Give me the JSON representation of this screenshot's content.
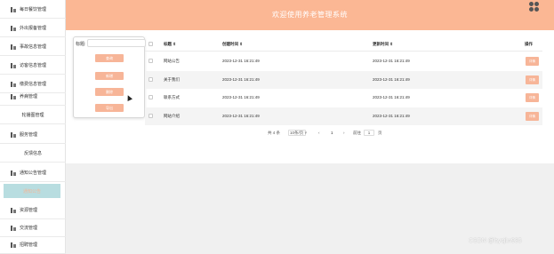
{
  "sidebar": {
    "items": [
      {
        "label": "每日餐饮管理"
      },
      {
        "label": "外出报备管理"
      },
      {
        "label": "事故信息管理"
      },
      {
        "label": "访客信息管理"
      },
      {
        "label": "缴费信息管理"
      },
      {
        "label": "养病管理"
      },
      {
        "label": "轮播图管理"
      },
      {
        "label": "服务管理"
      },
      {
        "label": "反馈信息"
      },
      {
        "label": "通知公告管理"
      },
      {
        "label": "通知公告"
      },
      {
        "label": "资源管理"
      },
      {
        "label": "交流管理"
      },
      {
        "label": "招聘管理"
      }
    ]
  },
  "header": {
    "title": "欢迎使用养老管理系统"
  },
  "search": {
    "label": "标题:",
    "buttons": [
      "查询",
      "新增",
      "删除",
      "导出"
    ]
  },
  "table": {
    "headers": [
      "标题",
      "创建时间",
      "更新时间",
      "操作"
    ],
    "rows": [
      {
        "title": "网站公告",
        "created": "2023-12-31 16:21:49",
        "updated": "2023-12-31 16:21:49",
        "action": "详情"
      },
      {
        "title": "关于我们",
        "created": "2023-12-31 16:21:49",
        "updated": "2023-12-31 16:21:49",
        "action": "详情"
      },
      {
        "title": "联系方式",
        "created": "2023-12-31 16:21:49",
        "updated": "2023-12-31 16:21:49",
        "action": "详情"
      },
      {
        "title": "网站介绍",
        "created": "2023-12-31 16:21:49",
        "updated": "2023-12-31 16:21:49",
        "action": "详情"
      }
    ]
  },
  "pagination": {
    "total": "共 4 条",
    "page_size": "10条/页",
    "prev": "‹",
    "current": "1",
    "next": "›",
    "goto_label": "前往",
    "goto_value": "1",
    "page_suffix": "页"
  },
  "watermark": "CSDN @bysjlw985",
  "colors": {
    "accent": "#fbb794",
    "button": "#f7b598",
    "active_menu": "#b8dde0"
  }
}
